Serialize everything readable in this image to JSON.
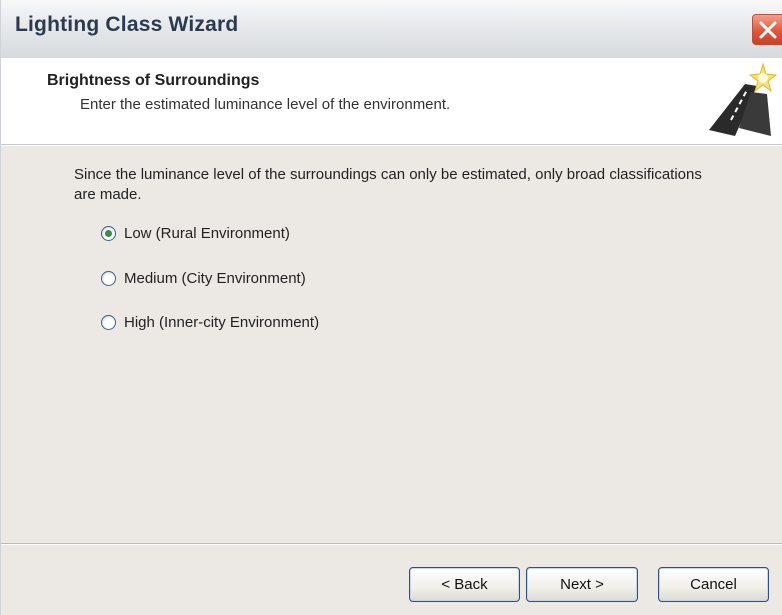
{
  "window": {
    "title": "Lighting Class Wizard"
  },
  "header": {
    "title": "Brightness of Surroundings",
    "subtitle": "Enter the estimated luminance level of the environment.",
    "icon": "road-star-icon"
  },
  "content": {
    "description": "Since the luminance level of the surroundings can only be estimated, only broad classifications are made.",
    "options": [
      {
        "label": "Low (Rural Environment)",
        "checked": true
      },
      {
        "label": "Medium (City Environment)",
        "checked": false
      },
      {
        "label": "High (Inner-city Environment)",
        "checked": false
      }
    ]
  },
  "footer": {
    "back_label": "< Back",
    "next_label": "Next >",
    "cancel_label": "Cancel"
  },
  "colors": {
    "title_text": "#2b3a4f",
    "close_button": "#e0583d",
    "radio_dot": "#3f8a4a",
    "button_border": "#2f4f7f"
  }
}
